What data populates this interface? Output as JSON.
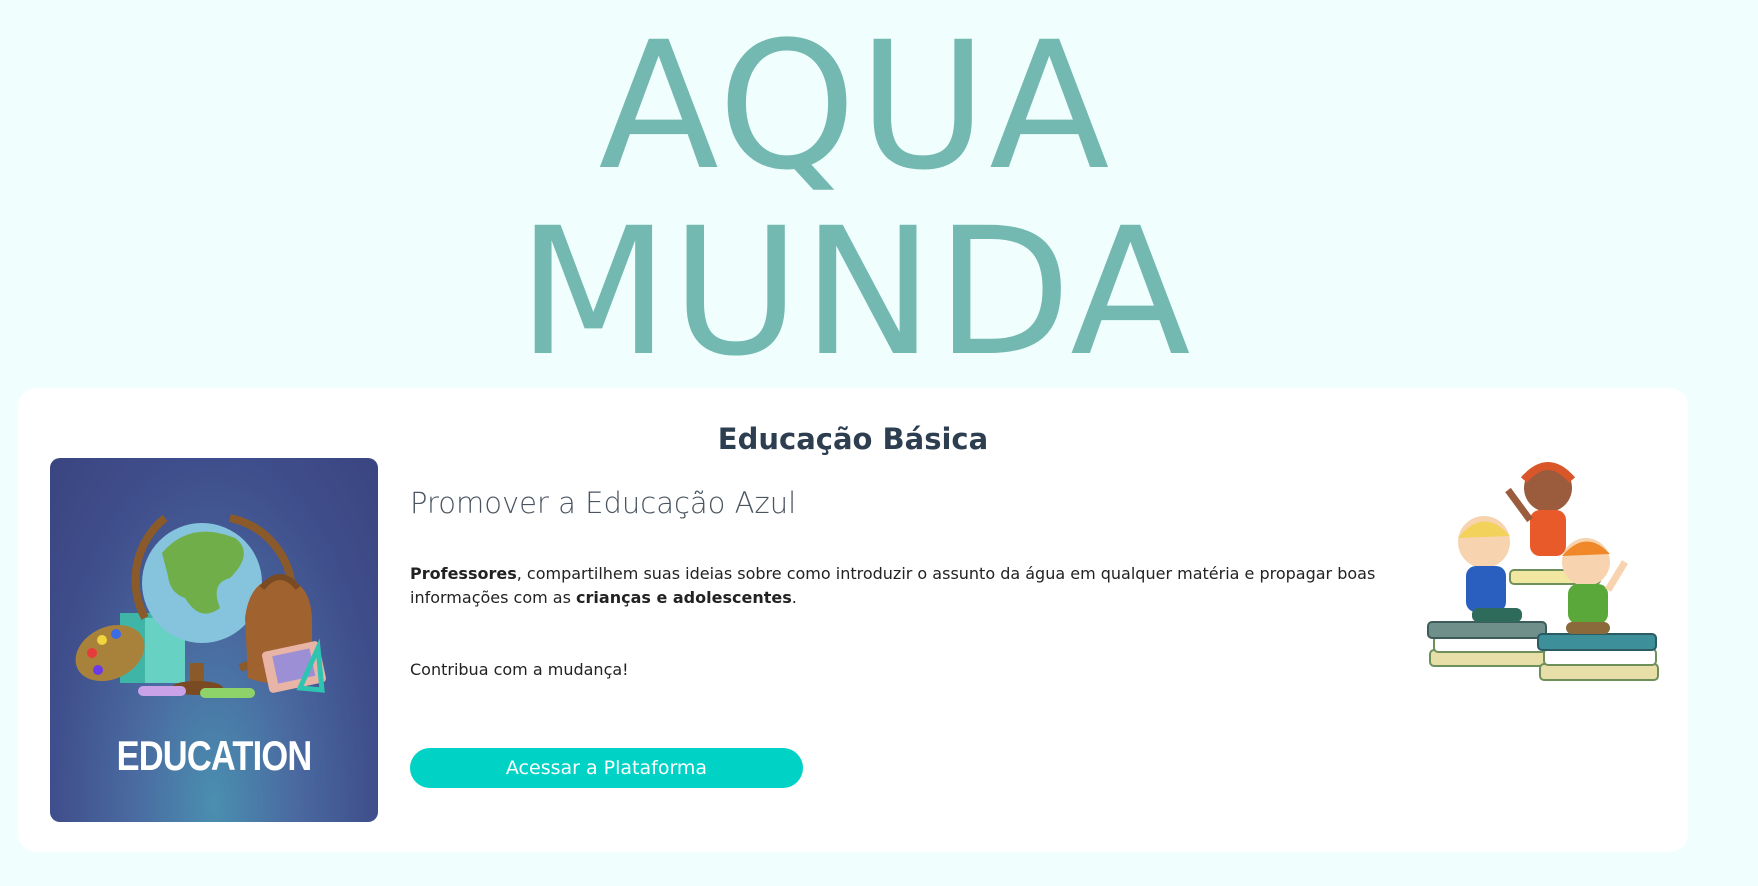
{
  "brand": {
    "line1": "AQUA",
    "line2": "MUNDA"
  },
  "card": {
    "title": "Educação Básica",
    "subtitle": "Promover a Educação Azul",
    "description": {
      "bold1": "Professores",
      "text1": ", compartilhem suas ideias sobre como introduzir o assunto da água em qualquer matéria e propagar boas informações com as ",
      "bold2": "crianças e adolescentes",
      "text2": "."
    },
    "call": "Contribua com a mudança!",
    "button_label": "Acessar a Plataforma",
    "image_label": "EDUCATION"
  },
  "colors": {
    "background": "#f0fffe",
    "brand": "#74b9b1",
    "button": "#00d2c6"
  },
  "icons": [
    "education-illustration",
    "kids-reading-illustration"
  ]
}
